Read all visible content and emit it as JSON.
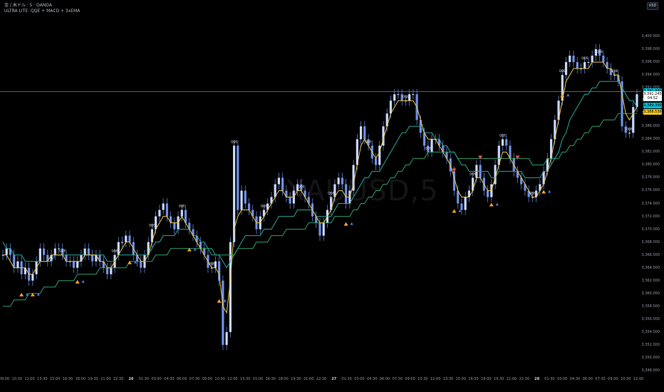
{
  "legend": {
    "symbol_line": "金 / 米ドル · 5 · OANDA",
    "indicator_line": "ULTRA LITE: QQE + MACD + 3xEMA"
  },
  "currency_badge": "USD",
  "watermark": "XAUUSD,5",
  "colors": {
    "background": "#000000",
    "candle": "#6f8fe6",
    "candle_light": "#c9d6ff",
    "ema_fast": "#e8c547",
    "ema_mid": "#26a69a",
    "ema_slow": "#2e9e6b",
    "buy_marker": "#f0a030",
    "sell_marker": "#ef5350",
    "signal_blue": "#4a7bd6",
    "hline": "#9598a1",
    "tag_teal": "#00bcd4",
    "tag_yellow": "#f0c419",
    "tag_white": "#ffffff"
  },
  "chart_data": {
    "type": "line",
    "title": "",
    "instrument": "XAUUSD",
    "timeframe": "5",
    "ylim": [
      3348,
      3402
    ],
    "y_ticks": [
      "3,400.000",
      "3,398.000",
      "3,396.000",
      "3,394.000",
      "3,392.000",
      "3,390.000",
      "3,388.000",
      "3,386.000",
      "3,384.000",
      "3,382.000",
      "3,380.000",
      "3,378.000",
      "3,376.000",
      "3,374.000",
      "3,372.000",
      "3,370.000",
      "3,368.000",
      "3,366.000",
      "3,364.000",
      "3,362.000",
      "3,360.000",
      "3,358.000",
      "3,356.000",
      "3,354.000",
      "3,352.000",
      "3,350.000",
      "3,348.000"
    ],
    "x_ticks": [
      "09:00",
      "10:30",
      "12:00",
      "13:30",
      "15:00",
      "16:30",
      "18:00",
      "19:30",
      "21:00",
      "22:30",
      "26",
      "01:30",
      "03:00",
      "04:30",
      "06:00",
      "07:30",
      "09:00",
      "10:30",
      "12:00",
      "13:30",
      "15:00",
      "16:30",
      "18:00",
      "19:30",
      "21:00",
      "22:30",
      "27",
      "01:30",
      "03:00",
      "04:30",
      "06:00",
      "07:30",
      "09:00",
      "10:30",
      "12:00",
      "13:30",
      "15:00",
      "16:30",
      "18:00",
      "19:30",
      "21:00",
      "22:30",
      "28",
      "01:30",
      "03:00",
      "04:30",
      "06:00",
      "07:30",
      "09:00",
      "10:30",
      "12:00"
    ],
    "day_ticks": [
      "26",
      "27",
      "28"
    ],
    "current_price_line": 3391.4,
    "price_tags": [
      {
        "value": 3391.499,
        "label": "3,391.499",
        "color": "teal"
      },
      {
        "value": 3391.0,
        "label": "3,391.245",
        "color": "white"
      },
      {
        "value": 3390.4,
        "label": "04:52",
        "color": "white"
      },
      {
        "value": 3389.3,
        "label": "3,389.399",
        "color": "teal"
      },
      {
        "value": 3388.3,
        "label": "3,388.538",
        "color": "yellow"
      }
    ],
    "series": [
      {
        "kind": "price",
        "values": [
          3366,
          3367,
          3366,
          3364,
          3365,
          3363,
          3364,
          3362,
          3363,
          3365,
          3367,
          3366,
          3365,
          3366,
          3367,
          3367,
          3366,
          3365,
          3365,
          3364,
          3365,
          3366,
          3367,
          3366,
          3365,
          3366,
          3365,
          3364,
          3363,
          3364,
          3366,
          3368,
          3368,
          3369,
          3368,
          3366,
          3365,
          3364,
          3366,
          3368,
          3370,
          3372,
          3373,
          3374,
          3372,
          3371,
          3370,
          3372,
          3373,
          3371,
          3370,
          3369,
          3368,
          3367,
          3366,
          3364,
          3364,
          3365,
          3362,
          3352,
          3354,
          3368,
          3383,
          3373,
          3376,
          3374,
          3373,
          3372,
          3370,
          3372,
          3373,
          3374,
          3375,
          3377,
          3378,
          3376,
          3375,
          3374,
          3376,
          3377,
          3376,
          3375,
          3374,
          3372,
          3371,
          3369,
          3371,
          3373,
          3375,
          3377,
          3378,
          3377,
          3374,
          3376,
          3380,
          3384,
          3386,
          3384,
          3383,
          3381,
          3380,
          3383,
          3386,
          3388,
          3390,
          3391,
          3391,
          3390,
          3390,
          3391,
          3391,
          3387,
          3385,
          3383,
          3382,
          3384,
          3384,
          3383,
          3382,
          3381,
          3379,
          3376,
          3374,
          3373,
          3375,
          3376,
          3378,
          3380,
          3378,
          3376,
          3375,
          3377,
          3380,
          3383,
          3384,
          3383,
          3381,
          3379,
          3378,
          3377,
          3376,
          3375,
          3375,
          3376,
          3377,
          3379,
          3381,
          3384,
          3387,
          3390,
          3394,
          3396,
          3397,
          3396,
          3395,
          3395,
          3396,
          3396,
          3397,
          3398,
          3397,
          3396,
          3395,
          3394,
          3394,
          3393,
          3386,
          3385,
          3385,
          3389,
          3391
        ]
      },
      {
        "kind": "ema",
        "name": "",
        "values": [
          3366,
          3366,
          3365,
          3364,
          3364,
          3364,
          3364,
          3363,
          3363,
          3364,
          3365,
          3365,
          3365,
          3366,
          3366,
          3366,
          3366,
          3365,
          3365,
          3365,
          3365,
          3365,
          3366,
          3366,
          3366,
          3366,
          3365,
          3365,
          3364,
          3364,
          3365,
          3366,
          3367,
          3368,
          3368,
          3367,
          3366,
          3365,
          3365,
          3366,
          3368,
          3370,
          3371,
          3372,
          3372,
          3371,
          3371,
          3371,
          3372,
          3371,
          3370,
          3369,
          3368,
          3367,
          3366,
          3365,
          3364,
          3364,
          3363,
          3358,
          3357,
          3362,
          3370,
          3372,
          3373,
          3373,
          3373,
          3372,
          3371,
          3371,
          3372,
          3373,
          3374,
          3375,
          3376,
          3376,
          3375,
          3375,
          3375,
          3376,
          3376,
          3375,
          3374,
          3373,
          3372,
          3371,
          3371,
          3372,
          3373,
          3375,
          3376,
          3376,
          3375,
          3375,
          3377,
          3380,
          3383,
          3384,
          3383,
          3382,
          3381,
          3382,
          3384,
          3386,
          3388,
          3389,
          3390,
          3390,
          3390,
          3390,
          3390,
          3389,
          3387,
          3385,
          3384,
          3384,
          3384,
          3383,
          3382,
          3381,
          3380,
          3378,
          3376,
          3375,
          3375,
          3375,
          3376,
          3378,
          3378,
          3377,
          3376,
          3376,
          3378,
          3380,
          3382,
          3382,
          3381,
          3380,
          3379,
          3378,
          3377,
          3376,
          3375,
          3375,
          3376,
          3377,
          3379,
          3381,
          3384,
          3387,
          3390,
          3393,
          3394,
          3395,
          3395,
          3395,
          3395,
          3395,
          3396,
          3396,
          3396,
          3396,
          3395,
          3395,
          3394,
          3394,
          3391,
          3388,
          3387,
          3388,
          3389
        ]
      },
      {
        "kind": "ema",
        "name": "",
        "values": [
          3368,
          3367,
          3367,
          3366,
          3366,
          3366,
          3365,
          3365,
          3365,
          3365,
          3365,
          3365,
          3365,
          3365,
          3366,
          3366,
          3366,
          3366,
          3366,
          3366,
          3366,
          3366,
          3366,
          3366,
          3366,
          3366,
          3366,
          3366,
          3365,
          3365,
          3365,
          3366,
          3366,
          3366,
          3366,
          3366,
          3366,
          3366,
          3366,
          3366,
          3367,
          3368,
          3368,
          3369,
          3369,
          3369,
          3369,
          3370,
          3370,
          3370,
          3370,
          3369,
          3369,
          3368,
          3368,
          3367,
          3367,
          3366,
          3366,
          3365,
          3364,
          3365,
          3366,
          3367,
          3368,
          3369,
          3369,
          3369,
          3369,
          3369,
          3370,
          3370,
          3370,
          3371,
          3372,
          3372,
          3372,
          3372,
          3372,
          3373,
          3373,
          3373,
          3373,
          3373,
          3372,
          3372,
          3372,
          3372,
          3372,
          3373,
          3374,
          3374,
          3374,
          3374,
          3375,
          3376,
          3377,
          3378,
          3378,
          3379,
          3379,
          3379,
          3380,
          3381,
          3382,
          3383,
          3384,
          3385,
          3385,
          3386,
          3386,
          3386,
          3386,
          3385,
          3385,
          3385,
          3384,
          3384,
          3383,
          3383,
          3382,
          3382,
          3381,
          3380,
          3380,
          3379,
          3379,
          3379,
          3379,
          3379,
          3379,
          3378,
          3378,
          3379,
          3379,
          3379,
          3379,
          3379,
          3379,
          3379,
          3378,
          3378,
          3378,
          3378,
          3378,
          3379,
          3379,
          3380,
          3381,
          3382,
          3384,
          3385,
          3387,
          3388,
          3389,
          3390,
          3391,
          3391,
          3392,
          3392,
          3393,
          3393,
          3393,
          3393,
          3393,
          3393,
          3392,
          3391,
          3390,
          3390,
          3389
        ]
      },
      {
        "kind": "ema",
        "name": "",
        "values": [
          3358,
          3358,
          3358,
          3359,
          3359,
          3359,
          3359,
          3360,
          3360,
          3360,
          3360,
          3361,
          3361,
          3361,
          3361,
          3362,
          3362,
          3362,
          3362,
          3362,
          3363,
          3363,
          3363,
          3363,
          3363,
          3363,
          3364,
          3364,
          3364,
          3364,
          3364,
          3364,
          3364,
          3364,
          3365,
          3365,
          3365,
          3365,
          3365,
          3365,
          3365,
          3366,
          3366,
          3366,
          3366,
          3367,
          3367,
          3367,
          3367,
          3367,
          3367,
          3367,
          3367,
          3367,
          3367,
          3367,
          3366,
          3366,
          3366,
          3366,
          3366,
          3366,
          3366,
          3367,
          3367,
          3367,
          3367,
          3367,
          3368,
          3368,
          3368,
          3368,
          3369,
          3369,
          3369,
          3369,
          3370,
          3370,
          3370,
          3370,
          3370,
          3370,
          3371,
          3371,
          3371,
          3371,
          3371,
          3371,
          3371,
          3372,
          3372,
          3372,
          3372,
          3372,
          3373,
          3373,
          3374,
          3374,
          3375,
          3375,
          3376,
          3376,
          3377,
          3377,
          3378,
          3378,
          3379,
          3379,
          3380,
          3380,
          3381,
          3381,
          3381,
          3381,
          3382,
          3382,
          3382,
          3382,
          3382,
          3382,
          3382,
          3382,
          3381,
          3381,
          3381,
          3381,
          3381,
          3381,
          3381,
          3381,
          3381,
          3381,
          3381,
          3381,
          3381,
          3381,
          3381,
          3381,
          3381,
          3381,
          3381,
          3381,
          3380,
          3380,
          3380,
          3380,
          3381,
          3381,
          3381,
          3381,
          3382,
          3382,
          3383,
          3383,
          3384,
          3384,
          3385,
          3385,
          3386,
          3386,
          3386,
          3387,
          3387,
          3387,
          3387,
          3388,
          3388,
          3388,
          3388,
          3388,
          3388
        ]
      }
    ],
    "buy_signals": [
      5,
      8,
      20,
      34,
      50,
      58,
      92,
      121,
      131,
      145,
      150
    ],
    "sell_signals": [
      121,
      128,
      138
    ],
    "annotations": [
      "QQE",
      "QQE",
      "QQE",
      "QQE",
      "QQE",
      "QQE",
      "QQE",
      "QQE",
      "QQE",
      "QQE",
      "QQE",
      "QQE",
      "QQE",
      "QQE",
      "QQE",
      "QQE",
      "QQE",
      "QQE",
      "QQE",
      "QQE"
    ]
  }
}
